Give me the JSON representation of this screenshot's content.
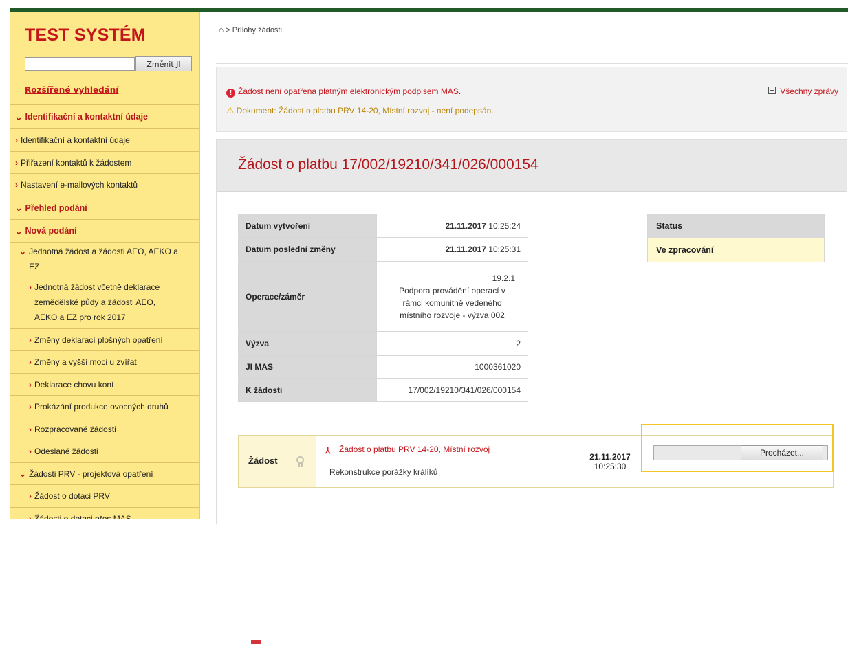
{
  "sidebar": {
    "logo": "TEST SYSTÉM",
    "search_value": "",
    "search_button": "Změnit JI",
    "advanced_search": "Rozšířené vyhledání",
    "items": [
      {
        "label": "Identifikační a kontaktní údaje"
      },
      {
        "label": "Identifikační a kontaktní údaje"
      },
      {
        "label": "Přiřazení kontaktů k žádostem"
      },
      {
        "label": "Nastavení e-mailových kontaktů"
      },
      {
        "label": "Přehled podání"
      },
      {
        "label": "Nová podání"
      },
      {
        "label": "Jednotná žádost a žádosti AEO, AEKO a EZ"
      },
      {
        "label": "Jednotná žádost včetně deklarace zemědělské půdy a žádosti AEO, AEKO a EZ pro rok 2017"
      },
      {
        "label": "Změny deklarací plošných opatření"
      },
      {
        "label": "Změny a vyšší moci u zvířat"
      },
      {
        "label": "Deklarace chovu koní"
      },
      {
        "label": "Prokázání produkce ovocných druhů"
      },
      {
        "label": "Rozpracované žádosti"
      },
      {
        "label": "Odeslané žádosti"
      },
      {
        "label": "Žádosti PRV - projektová opatření"
      },
      {
        "label": "Žádost o dotaci PRV"
      },
      {
        "label": "Žádosti o dotaci přes MAS"
      }
    ]
  },
  "breadcrumb": {
    "home_icon": "home-icon",
    "path": "> Přílohy žádosti"
  },
  "messages": {
    "error": "Žádost není opatřena platným elektronickým podpisem MAS.",
    "warning": "Dokument: Žádost o platbu PRV 14-20, Místní rozvoj - není podepsán.",
    "all_messages": "Všechny zprávy"
  },
  "page": {
    "title": "Žádost o platbu 17/002/19210/341/026/000154"
  },
  "details": {
    "created_label": "Datum vytvoření",
    "created_date": "21.11.2017",
    "created_time": "10:25:24",
    "modified_label": "Datum poslední změny",
    "modified_date": "21.11.2017",
    "modified_time": "10:25:31",
    "operation_label": "Operace/záměr",
    "operation_lines": [
      "19.2.1",
      "Podpora provádění operací v",
      "rámci komunitně vedeného",
      "místního rozvoje - výzva 002"
    ],
    "call_label": "Výzva",
    "call_value": "2",
    "mas_label": "JI MAS",
    "mas_value": "1000361020",
    "request_label": "K žádosti",
    "request_value": "17/002/19210/341/026/000154"
  },
  "status": {
    "header": "Status",
    "value": "Ve zpracování"
  },
  "attachment": {
    "label": "Žádost",
    "link": "Žádost o platbu PRV 14-20, Místní rozvoj",
    "description": "Rekonstrukce porážky králíků",
    "date": "21.11.2017",
    "time": "10:25:30",
    "browse_button": "Procházet..."
  },
  "colors": {
    "brand_red": "#c3161c",
    "sidebar_bg": "#fde98a",
    "highlight": "#f3c52d"
  }
}
